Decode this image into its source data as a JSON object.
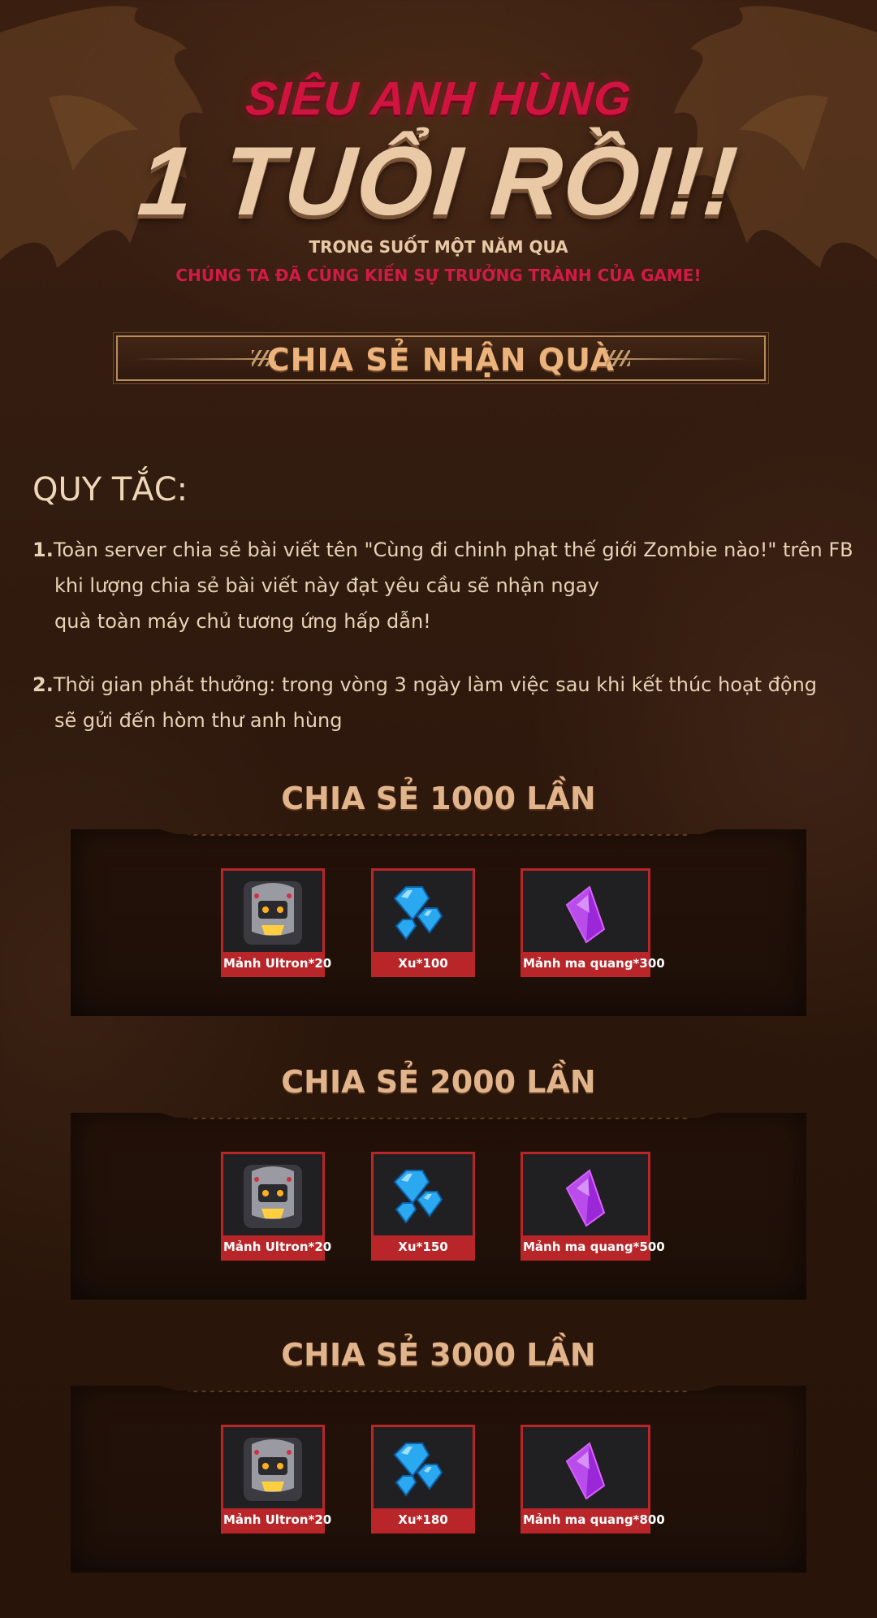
{
  "header": {
    "title_top": "SIÊU ANH HÙNG",
    "title_main": "1 TUỔI RỒI!!",
    "subtitle_1": "TRONG SUỐT MỘT NĂM QUA",
    "subtitle_2": "CHÚNG TA ĐÃ CÙNG KIẾN SỰ TRƯỞNG TRÀNH CỦA GAME!"
  },
  "share_banner": {
    "label": "CHIA SẺ NHẬN QUÀ"
  },
  "rules": {
    "heading": "QUY TẮC:",
    "items": [
      {
        "number": "1.",
        "lines": [
          "Toàn server chia sẻ bài viết tên \"Cùng đi chinh phạt thế giới Zombie nào!\" trên FB",
          "khi lượng chia sẻ bài viết này đạt yêu cầu sẽ nhận ngay",
          "quà toàn máy chủ tương ứng hấp dẫn!"
        ]
      },
      {
        "number": "2.",
        "lines": [
          "Thời gian phát thưởng: trong vòng 3 ngày làm việc sau khi kết thúc hoạt động",
          "sẽ gửi đến hòm thư anh hùng"
        ]
      }
    ]
  },
  "tiers": [
    {
      "title": "CHIA SẺ 1000 LẦN",
      "rewards": [
        {
          "name": "Mảnh Ultron*20",
          "icon": "robot-icon"
        },
        {
          "name": "Xu*100",
          "icon": "blue-gems-icon"
        },
        {
          "name": "Mảnh ma quang*300",
          "icon": "purple-crystal-icon"
        }
      ]
    },
    {
      "title": "CHIA SẺ 2000 LẦN",
      "rewards": [
        {
          "name": "Mảnh Ultron*20",
          "icon": "robot-icon"
        },
        {
          "name": "Xu*150",
          "icon": "blue-gems-icon"
        },
        {
          "name": "Mảnh ma quang*500",
          "icon": "purple-crystal-icon"
        }
      ]
    },
    {
      "title": "CHIA SẺ 3000 LẦN",
      "rewards": [
        {
          "name": "Mảnh Ultron*20",
          "icon": "robot-icon"
        },
        {
          "name": "Xu*180",
          "icon": "blue-gems-icon"
        },
        {
          "name": "Mảnh ma quang*800",
          "icon": "purple-crystal-icon"
        }
      ]
    }
  ],
  "colors": {
    "accent_red": "#d0133f",
    "gold_text": "#e9c9a6",
    "reward_frame": "#b8262a",
    "background": "#321b0f"
  }
}
